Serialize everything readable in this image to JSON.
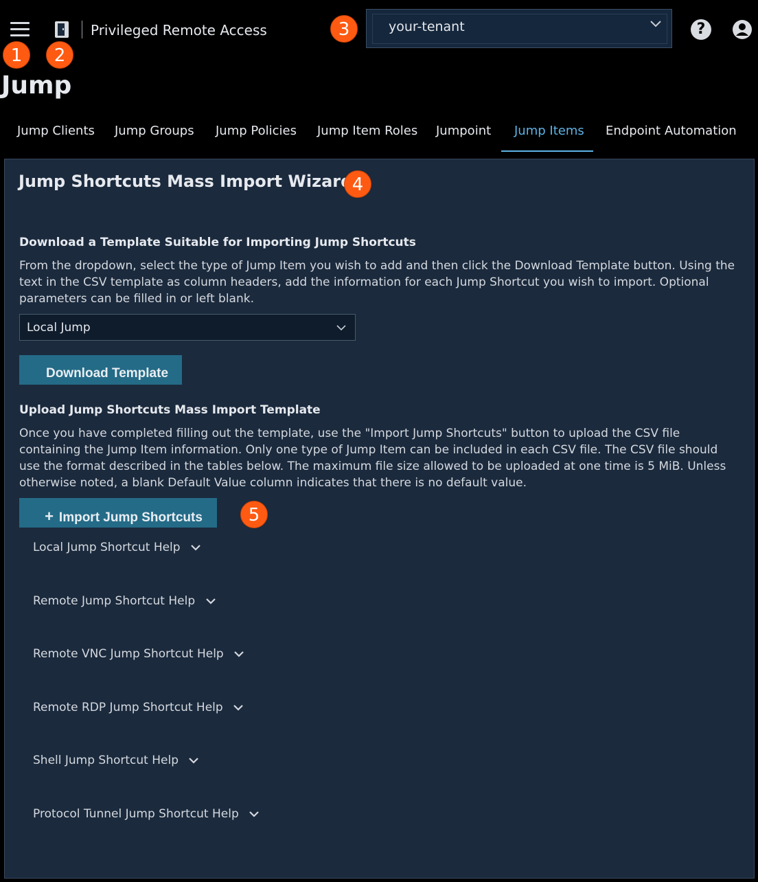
{
  "header": {
    "app_title": "Privileged Remote Access",
    "tenant": "your-tenant",
    "help_symbol": "?",
    "icons": [
      "menu-icon",
      "access-console-icon",
      "chevron-down-icon",
      "help-icon",
      "user-icon"
    ]
  },
  "markers": [
    "1",
    "2",
    "3",
    "4",
    "5"
  ],
  "page": {
    "title": "Jump"
  },
  "tabs": [
    {
      "label": "Jump Clients",
      "active": false
    },
    {
      "label": "Jump Groups",
      "active": false
    },
    {
      "label": "Jump Policies",
      "active": false
    },
    {
      "label": "Jump Item Roles",
      "active": false
    },
    {
      "label": "Jumpoint",
      "active": false
    },
    {
      "label": "Jump Items",
      "active": true
    },
    {
      "label": "Endpoint Automation",
      "active": false
    }
  ],
  "wizard": {
    "title": "Jump Shortcuts Mass Import Wizard",
    "download_heading": "Download a Template Suitable for Importing Jump Shortcuts",
    "download_text": "From the dropdown, select the type of Jump Item you wish to add and then click the Download Template button. Using the text in the CSV template as column headers, add the information for each Jump Shortcut you wish to import. Optional parameters can be filled in or left blank.",
    "jump_type_selected": "Local Jump",
    "download_button": "Download Template",
    "upload_heading": "Upload Jump Shortcuts Mass Import Template",
    "upload_text": "Once you have completed filling out the template, use the \"Import Jump Shortcuts\" button to upload the CSV file containing the Jump Item information. Only one type of Jump Item can be included in each CSV file. The CSV file should use the format described in the tables below. The maximum file size allowed to be uploaded at one time is 5 MiB. Unless otherwise noted, a blank Default Value column indicates that there is no default value.",
    "import_button": "Import Jump Shortcuts",
    "help_sections": [
      "Local Jump Shortcut Help",
      "Remote Jump Shortcut Help",
      "Remote VNC Jump Shortcut Help",
      "Remote RDP Jump Shortcut Help",
      "Shell Jump Shortcut Help",
      "Protocol Tunnel Jump Shortcut Help"
    ]
  },
  "colors": {
    "accent": "#5db3e6",
    "button": "#246b87",
    "panel": "#1b2a3d",
    "marker": "#ff5a12"
  }
}
